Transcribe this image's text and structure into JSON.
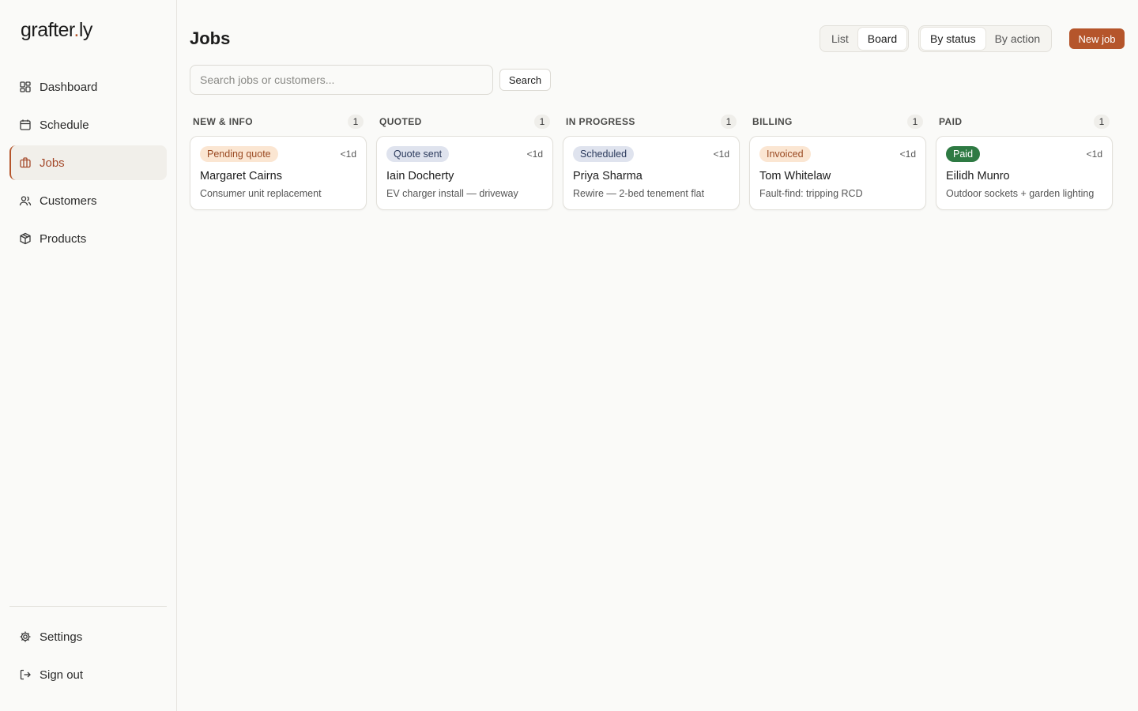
{
  "app": {
    "logo_prefix": "grafter",
    "logo_dot": ".",
    "logo_suffix": "ly"
  },
  "sidebar": {
    "items": [
      {
        "label": "Dashboard",
        "icon": "dashboard-icon"
      },
      {
        "label": "Schedule",
        "icon": "calendar-icon"
      },
      {
        "label": "Jobs",
        "icon": "briefcase-icon",
        "active": true
      },
      {
        "label": "Customers",
        "icon": "users-icon"
      },
      {
        "label": "Products",
        "icon": "box-icon"
      }
    ],
    "footer": [
      {
        "label": "Settings",
        "icon": "gear-icon"
      },
      {
        "label": "Sign out",
        "icon": "sign-out-icon"
      }
    ]
  },
  "header": {
    "title": "Jobs",
    "view_toggle": {
      "list": "List",
      "board": "Board",
      "selected": "Board"
    },
    "group_toggle": {
      "status": "By status",
      "action": "By action",
      "selected": "By status"
    },
    "new_job": "New job"
  },
  "search": {
    "placeholder": "Search jobs or customers...",
    "value": "",
    "button": "Search"
  },
  "colors": {
    "accent": "#b5552b",
    "background": "#fafaf8"
  },
  "columns": [
    {
      "title": "NEW & INFO",
      "count": "1",
      "card": {
        "badge": "Pending quote",
        "badge_bg": "#fbe6d2",
        "badge_fg": "#9a4a22",
        "age": "<1d",
        "name": "Margaret Cairns",
        "desc": "Consumer unit replacement"
      }
    },
    {
      "title": "QUOTED",
      "count": "1",
      "card": {
        "badge": "Quote sent",
        "badge_bg": "#dfe3ee",
        "badge_fg": "#2b3a5c",
        "age": "<1d",
        "name": "Iain Docherty",
        "desc": "EV charger install — driveway"
      }
    },
    {
      "title": "IN PROGRESS",
      "count": "1",
      "card": {
        "badge": "Scheduled",
        "badge_bg": "#dfe3ee",
        "badge_fg": "#2b3a5c",
        "age": "<1d",
        "name": "Priya Sharma",
        "desc": "Rewire — 2-bed tenement flat"
      }
    },
    {
      "title": "BILLING",
      "count": "1",
      "card": {
        "badge": "Invoiced",
        "badge_bg": "#fbe6d2",
        "badge_fg": "#9a4a22",
        "age": "<1d",
        "name": "Tom Whitelaw",
        "desc": "Fault-find: tripping RCD"
      }
    },
    {
      "title": "PAID",
      "count": "1",
      "card": {
        "badge": "Paid",
        "badge_bg": "#2e7a43",
        "badge_fg": "#ffffff",
        "age": "<1d",
        "name": "Eilidh Munro",
        "desc": "Outdoor sockets + garden lighting"
      }
    }
  ]
}
